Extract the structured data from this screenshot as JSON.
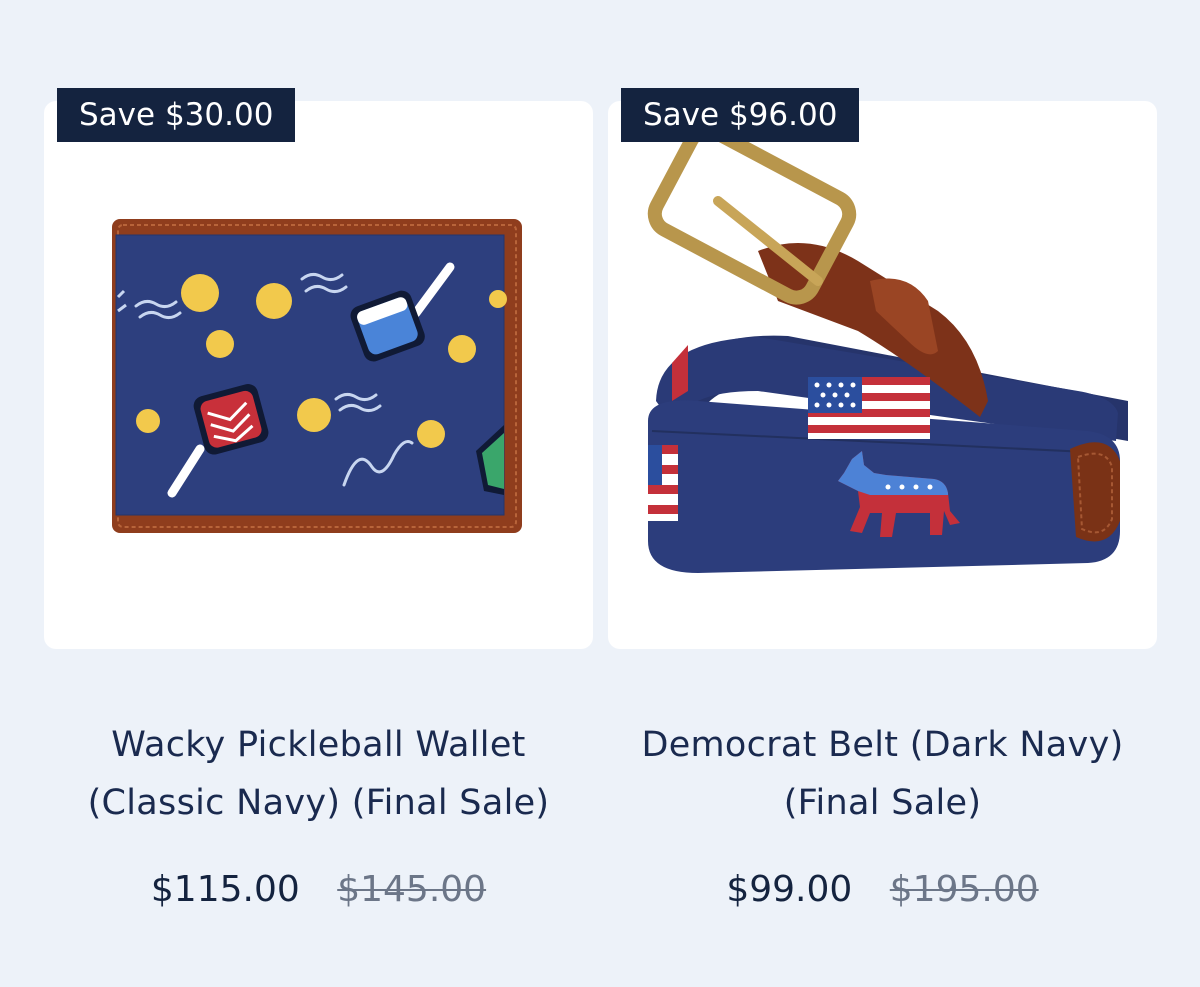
{
  "products": [
    {
      "badge": "Save $30.00",
      "title": "Wacky Pickleball Wallet (Classic Navy) (Final Sale)",
      "price": "$115.00",
      "compare_price": "$145.00",
      "image_icon": "pickleball-wallet-icon"
    },
    {
      "badge": "Save $96.00",
      "title": "Democrat Belt (Dark Navy) (Final Sale)",
      "price": "$99.00",
      "compare_price": "$195.00",
      "image_icon": "democrat-belt-icon"
    }
  ],
  "colors": {
    "page_bg": "#edf2f9",
    "badge_bg": "#14233f",
    "text": "#1a2a4f",
    "navy_needlepoint": "#2c3e7c",
    "leather": "#8b3a1c",
    "brass": "#b3924a"
  }
}
